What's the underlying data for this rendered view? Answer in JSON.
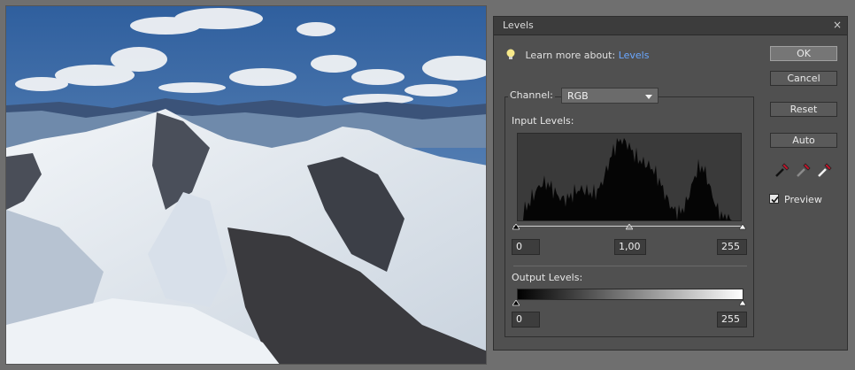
{
  "dialog": {
    "title": "Levels",
    "close_glyph": "×",
    "learn_prefix": "Learn more about:",
    "learn_link": "Levels",
    "channel_label": "Channel:",
    "channel_value": "RGB",
    "input_levels_label": "Input Levels:",
    "input_black": "0",
    "input_gamma": "1,00",
    "input_white": "255",
    "output_levels_label": "Output Levels:",
    "output_black": "0",
    "output_white": "255",
    "preview_label": "Preview",
    "preview_checked": true
  },
  "buttons": {
    "ok": "OK",
    "cancel": "Cancel",
    "reset": "Reset",
    "auto": "Auto"
  },
  "icons": {
    "bulb": "lightbulb-icon",
    "black_dropper": "black-eyedropper-icon",
    "gray_dropper": "gray-eyedropper-icon",
    "white_dropper": "white-eyedropper-icon"
  },
  "colors": {
    "dropper_red": "#c0142a",
    "link_blue": "#6aa7ff"
  }
}
